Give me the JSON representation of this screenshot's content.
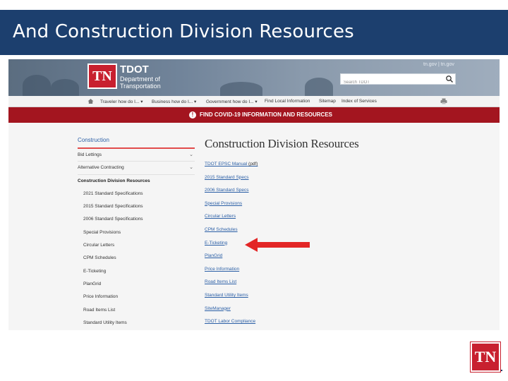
{
  "slide": {
    "title": "And Construction Division Resources",
    "corner_logo": "TN",
    "header_color": "#1c3f6e",
    "accent_color": "#c8202f"
  },
  "site": {
    "logo_mark": "TN",
    "logo_name": "TDOT",
    "logo_sub1": "Department of",
    "logo_sub2": "Transportation",
    "gov_link": "tn.gov | tn.gov",
    "search_placeholder": "Search TDOT",
    "nav": [
      "Traveler how do I...",
      "Business how do I...",
      "Government how do I...",
      "Find Local Information",
      "Sitemap",
      "Index of Services"
    ],
    "covid_banner": "FIND COVID-19 INFORMATION AND RESOURCES",
    "covid_banner_color": "#a3151f"
  },
  "sidebar": {
    "heading": "Construction",
    "expanders": [
      "Bid Lettings",
      "Alternative Contracting"
    ],
    "active": "Construction Division Resources",
    "subitems": [
      "2021 Standard Specifications",
      "2015 Standard Specifications",
      "2006 Standard Specifications",
      "Special Provisions",
      "Circular Letters",
      "CPM Schedules",
      "E-Ticketing",
      "PlanGrid",
      "Price Information",
      "Road Items List",
      "Standard Utility Items"
    ]
  },
  "main": {
    "title": "Construction Division Resources",
    "first_link": "TDOT EPSC Manual",
    "first_link_suffix": " (pdf)",
    "links": [
      "2015 Standard Specs",
      "2006 Standard Specs",
      "Special Provisions",
      "Circular Letters",
      "CPM Schedules",
      "E-Ticketing",
      "PlanGrid",
      "Price Information",
      "Road Items List",
      "Standard Utility Items",
      "SiteManager",
      "TDOT Labor Compliance"
    ]
  }
}
